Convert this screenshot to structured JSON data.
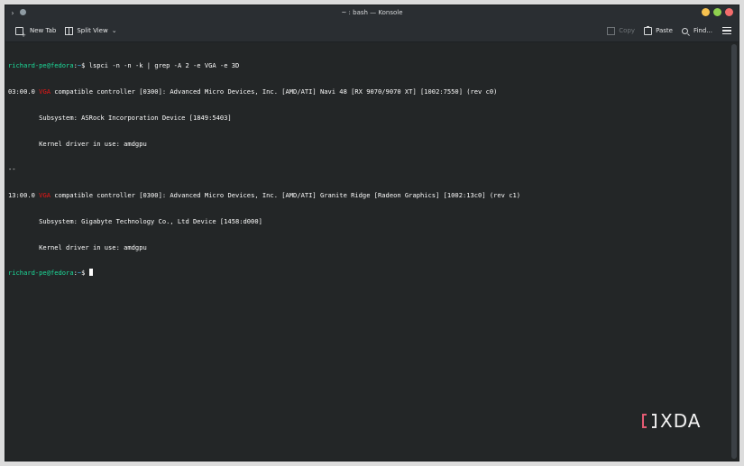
{
  "window": {
    "title": "~ : bash — Konsole",
    "controls": {
      "minimize_color": "#f6c14f",
      "maximize_color": "#8fd14f",
      "close_color": "#f46c6c"
    }
  },
  "toolbar": {
    "new_tab_label": "New Tab",
    "split_view_label": "Split View",
    "copy_label": "Copy",
    "paste_label": "Paste",
    "find_label": "Find...",
    "icons": [
      "new-tab-icon",
      "split-view-icon",
      "copy-icon",
      "paste-icon",
      "search-icon",
      "hamburger-menu-icon"
    ]
  },
  "terminal": {
    "colors": {
      "prompt_user": "#1cdc9a",
      "prompt_path": "#3daee9",
      "match": "#ed1515",
      "text": "#fcfcfc",
      "background": "#232627"
    },
    "prompt": {
      "user": "richard-pe@fedora",
      "sep": ":",
      "path": "~",
      "symbol": "$ "
    },
    "command": "lspci -n -n -k | grep -A 2 -e VGA -e 3D",
    "entries": [
      {
        "prefix": "03:00.0 ",
        "match": "VGA",
        "rest": " compatible controller [0300]: Advanced Micro Devices, Inc. [AMD/ATI] Navi 48 [RX 9070/9070 XT] [1002:7550] (rev c0)",
        "subsystem": "        Subsystem: ASRock Incorporation Device [1849:5403]",
        "driver": "        Kernel driver in use: amdgpu"
      },
      {
        "prefix": "13:00.0 ",
        "match": "VGA",
        "rest": " compatible controller [0300]: Advanced Micro Devices, Inc. [AMD/ATI] Granite Ridge [Radeon Graphics] [1002:13c0] (rev c1)",
        "subsystem": "        Subsystem: Gigabyte Technology Co., Ltd Device [1458:d000]",
        "driver": "        Kernel driver in use: amdgpu"
      }
    ],
    "group_separator": "--"
  },
  "watermark": {
    "text": "XDA"
  }
}
